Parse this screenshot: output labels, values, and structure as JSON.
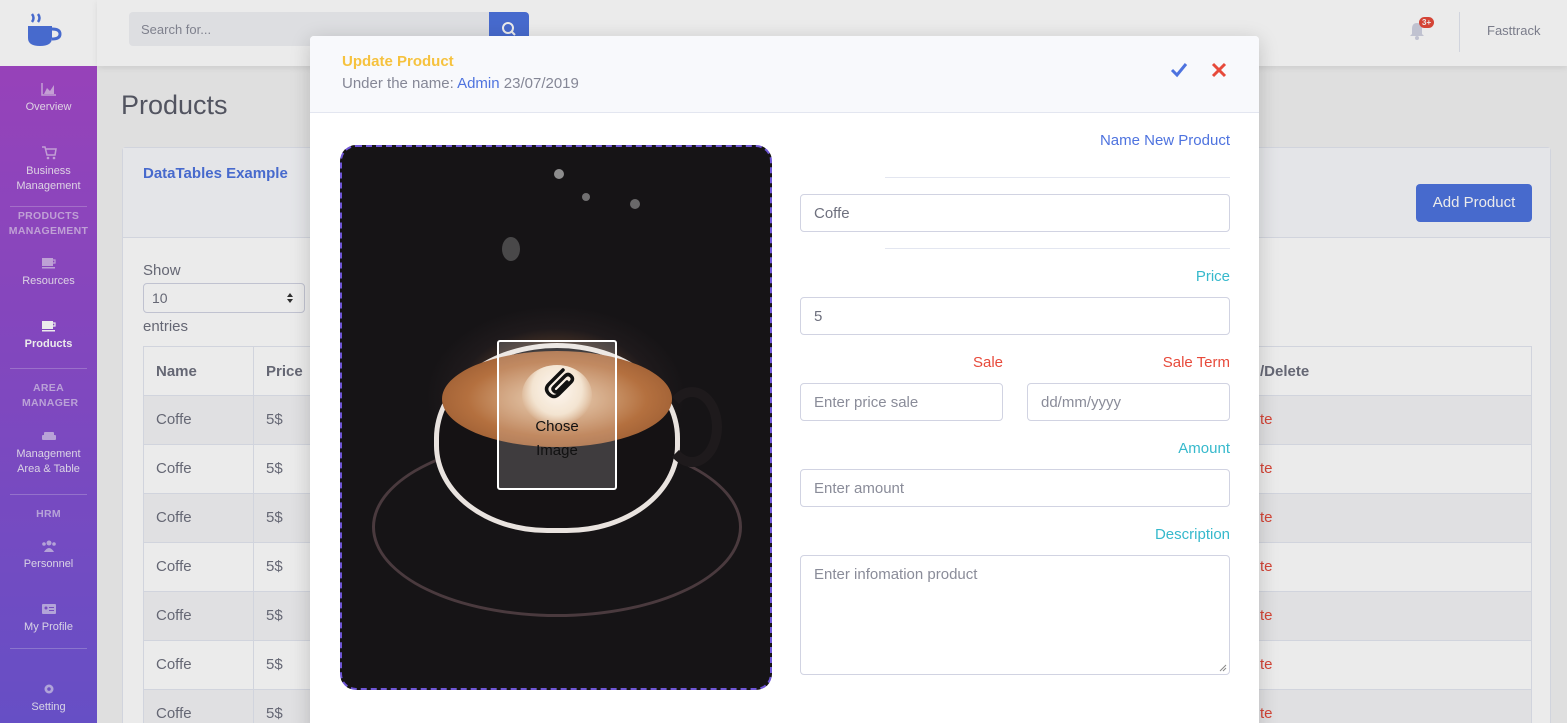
{
  "topbar": {
    "search_placeholder": "Search for...",
    "notification_count": "3+",
    "username": "Fasttrack"
  },
  "sidebar": {
    "items": [
      {
        "label": "Overview",
        "icon": "chart-area-icon"
      },
      {
        "label": "Business Management",
        "icon": "shopping-cart-icon"
      },
      {
        "label": "Resources",
        "icon": "coffee-icon"
      },
      {
        "label": "Products",
        "icon": "coffee-icon",
        "active": true
      },
      {
        "label": "Management Area & Table",
        "icon": "couch-icon"
      },
      {
        "label": "Personnel",
        "icon": "users-icon"
      },
      {
        "label": "My Profile",
        "icon": "id-card-icon"
      },
      {
        "label": "Setting",
        "icon": "gear-icon"
      }
    ],
    "headings": {
      "products_management": "PRODUCTS MANAGEMENT",
      "area_manager": "AREA MANAGER",
      "hrm": "HRM"
    }
  },
  "main": {
    "page_title": "Products",
    "card_title": "DataTables Example",
    "add_button": "Add Product",
    "show_label": "Show",
    "entries_value": "10",
    "entries_label": "entries",
    "columns": [
      "Name",
      "Price",
      "/Delete"
    ],
    "rows": [
      {
        "name": "Coffe",
        "price": "5$",
        "action": "te"
      },
      {
        "name": "Coffe",
        "price": "5$",
        "action": "te"
      },
      {
        "name": "Coffe",
        "price": "5$",
        "action": "te"
      },
      {
        "name": "Coffe",
        "price": "5$",
        "action": "te"
      },
      {
        "name": "Coffe",
        "price": "5$",
        "action": "te"
      },
      {
        "name": "Coffe",
        "price": "5$",
        "action": "te"
      },
      {
        "name": "Coffe",
        "price": "5$",
        "action": "te"
      }
    ]
  },
  "modal": {
    "title": "Update Product",
    "sub_prefix": "Under the name:",
    "sub_user": "Admin",
    "sub_date": "23/07/2019",
    "chose_image_line1": "Chose",
    "chose_image_line2": "Image",
    "name_label": "Name New Product",
    "name_value": "Coffe",
    "price_label": "Price",
    "price_value": "5",
    "sale_label": "Sale",
    "sale_term_label": "Sale Term",
    "sale_placeholder": "Enter price sale",
    "sale_term_placeholder": "dd/mm/yyyy",
    "amount_label": "Amount",
    "amount_placeholder": "Enter amount",
    "description_label": "Description",
    "description_placeholder": "Enter infomation product"
  },
  "colors": {
    "primary": "#4e73df",
    "warning": "#f6c23e",
    "danger": "#e74a3b",
    "info": "#36b9cc"
  }
}
